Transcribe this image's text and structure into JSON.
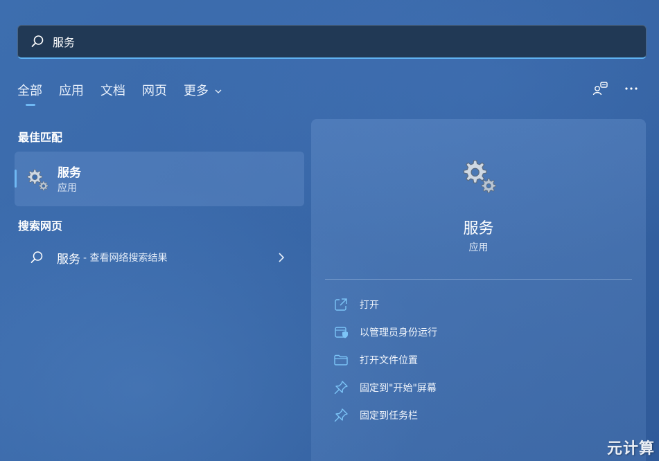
{
  "search": {
    "value": "服务",
    "placeholder": ""
  },
  "tabs": [
    {
      "label": "全部",
      "active": true
    },
    {
      "label": "应用",
      "active": false
    },
    {
      "label": "文档",
      "active": false
    },
    {
      "label": "网页",
      "active": false
    },
    {
      "label": "更多",
      "active": false
    }
  ],
  "top_right_icons": [
    "account-switch-icon",
    "more-options-icon"
  ],
  "best_match": {
    "section_title": "最佳匹配",
    "name": "服务",
    "type": "应用",
    "icon": "gears-icon"
  },
  "web_search": {
    "section_title": "搜索网页",
    "term": "服务",
    "hint": "- 查看网络搜索结果"
  },
  "detail": {
    "name": "服务",
    "type": "应用",
    "actions": [
      {
        "label": "打开",
        "icon": "open-external-icon"
      },
      {
        "label": "以管理员身份运行",
        "icon": "shield-admin-icon"
      },
      {
        "label": "打开文件位置",
        "icon": "folder-icon"
      },
      {
        "label": "固定到\"开始\"屏幕",
        "icon": "pin-icon"
      },
      {
        "label": "固定到任务栏",
        "icon": "pin-icon"
      }
    ]
  },
  "watermark": "元计算",
  "colors": {
    "accent": "#6fb8f3",
    "background": "#3a69aa",
    "search_bg": "#213955"
  }
}
